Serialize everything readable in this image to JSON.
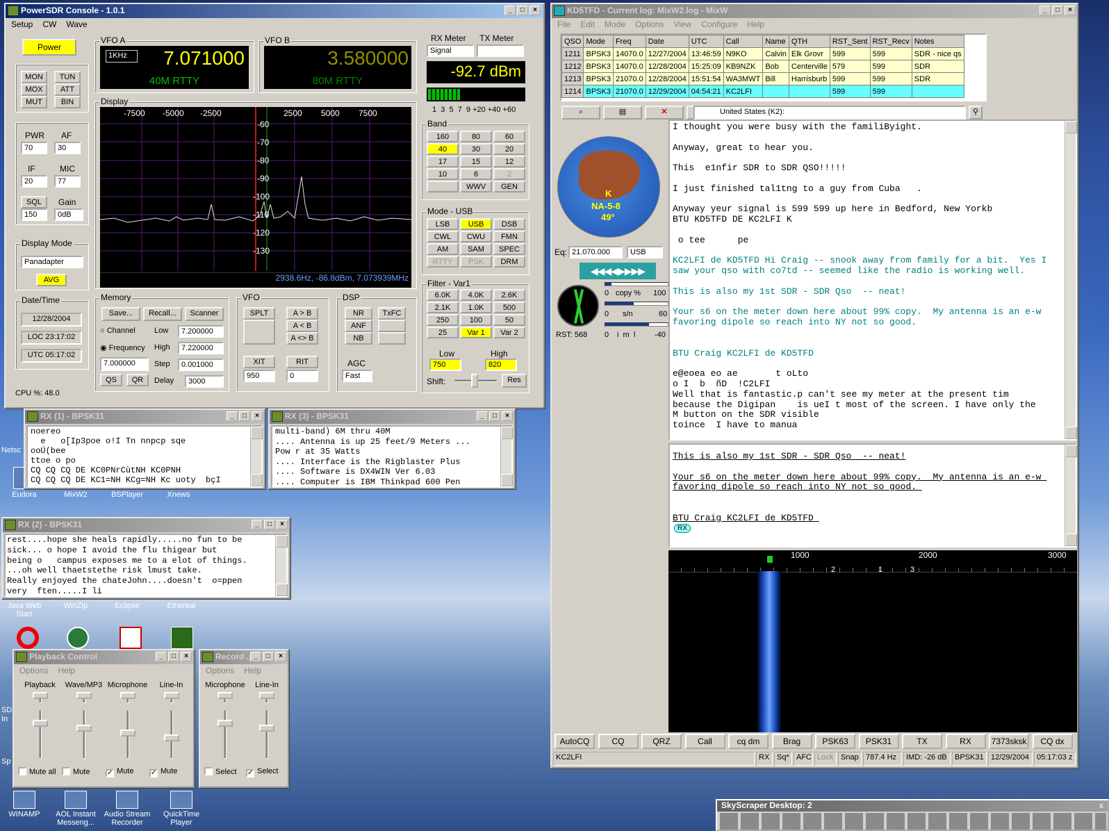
{
  "desktop": {
    "icons": [
      {
        "label": "Netsc",
        "x": 0
      },
      {
        "label": "Eudora"
      },
      {
        "label": "MixW2"
      },
      {
        "label": "BSPlayer"
      },
      {
        "label": "Xnews"
      },
      {
        "label": "Java Web Start"
      },
      {
        "label": "WinZip"
      },
      {
        "label": "Eclipse"
      },
      {
        "label": "Ethereal"
      },
      {
        "label": "WINAMP"
      },
      {
        "label": "AOL Instant Messeng..."
      },
      {
        "label": "Audio Stream Recorder"
      },
      {
        "label": "QuickTime Player"
      }
    ],
    "partial": [
      "SD",
      "In",
      "Sp"
    ]
  },
  "powersdr": {
    "title": "PowerSDR Console - 1.0.1",
    "menu": [
      "Setup",
      "CW",
      "Wave"
    ],
    "power": "Power",
    "mon": "MON",
    "tun": "TUN",
    "mox": "MOX",
    "att": "ATT",
    "mut": "MUT",
    "bin": "BIN",
    "pwr": {
      "label": "PWR",
      "value": "70"
    },
    "af": {
      "label": "AF",
      "value": "30"
    },
    "if": {
      "label": "IF",
      "value": "20"
    },
    "mic": {
      "label": "MIC",
      "value": "77"
    },
    "sql": {
      "label": "SQL",
      "value": "150"
    },
    "gain": {
      "label": "Gain",
      "value": "0dB"
    },
    "display_mode": {
      "label": "Display Mode",
      "value": "Panadapter",
      "avg": "AVG"
    },
    "datetime": {
      "label": "Date/Time",
      "date": "12/28/2004",
      "loc": "LOC 23:17:02",
      "utc": "UTC 05:17:02"
    },
    "cpu": "CPU %: 48.0",
    "vfoa": {
      "label": "VFO A",
      "step": "1KHz",
      "freq": "7.071000",
      "mode": "40M RTTY"
    },
    "vfob": {
      "label": "VFO B",
      "freq": "3.580000",
      "mode": "80M RTTY"
    },
    "display": {
      "label": "Display",
      "xlabels": [
        "-7500",
        "-5000",
        "-2500",
        "2500",
        "5000",
        "7500"
      ],
      "ylabels": [
        "-60",
        "-70",
        "-80",
        "-90",
        "-100",
        "-110",
        "-120",
        "-130"
      ],
      "readout": "2938.6Hz, -86.8dBm, 7.073939MHz"
    },
    "meter": {
      "rx_label": "RX Meter",
      "tx_label": "TX Meter",
      "rx_select": "Signal",
      "value": "-92.7 dBm",
      "scale": "1  3  5  7  9 +20 +40 +60"
    },
    "band": {
      "label": "Band",
      "buttons": [
        "160",
        "80",
        "60",
        "40",
        "30",
        "20",
        "17",
        "15",
        "12",
        "10",
        "6",
        "2",
        "",
        "WWV",
        "GEN"
      ]
    },
    "mode": {
      "label": "Mode - USB",
      "buttons": [
        "LSB",
        "USB",
        "DSB",
        "CWL",
        "CWU",
        "FMN",
        "AM",
        "SAM",
        "SPEC",
        "RTTY",
        "PSK",
        "DRM"
      ]
    },
    "filter": {
      "label": "Filter - Var1",
      "buttons": [
        "6.0K",
        "4.0K",
        "2.6K",
        "2.1K",
        "1.0K",
        "500",
        "250",
        "100",
        "50",
        "25",
        "Var 1",
        "Var 2"
      ],
      "low_label": "Low",
      "high_label": "High",
      "low": "750",
      "high": "820",
      "shift": "Shift:",
      "reset": "Res"
    },
    "memory": {
      "label": "Memory",
      "save": "Save...",
      "recall": "Recall...",
      "scanner": "Scanner",
      "channel": "Channel",
      "frequency": "Frequency",
      "low_label": "Low",
      "low": "7.200000",
      "high_label": "High",
      "high": "7.220000",
      "step_label": "Step",
      "step": "0.001000",
      "delay_label": "Delay",
      "delay": "3000",
      "freq": "7.000000",
      "qs": "QS",
      "qr": "QR"
    },
    "vfo": {
      "label": "VFO",
      "splt": "SPLT",
      "ab": "A > B",
      "alb": "A < B",
      "axb": "A <> B",
      "xit": "XIT",
      "rit": "RIT",
      "xitv": "950",
      "ritv": "0"
    },
    "dsp": {
      "label": "DSP",
      "nr": "NR",
      "txfc": "TxFC",
      "anf": "ANF",
      "nb": "NB",
      "agc": "AGC",
      "agcv": "Fast"
    }
  },
  "rx1": {
    "title": "RX (1) - BPSK31",
    "lines": [
      "noereo",
      "  e   o[Ip3poe o!I Tn nnpcp sqe",
      "ooÚ(bee",
      "ttoe o po",
      "CQ CQ CQ DE KC0PNrCùtNH KC0PNH",
      "CQ CQ CQ DE KC1=NH KCg=NH Kc uoty  bçI"
    ]
  },
  "rx3": {
    "title": "RX (3) - BPSK31",
    "lines": [
      "multi-band) 6M thru 40M",
      ".... Antenna is up 25 feet/9 Meters ...",
      "Pow r at 35 Watts",
      ".... Interface is the Rigblaster Plus",
      ".... Software is DX4WIN Ver 6.03",
      ".... Computer is IBM Thinkpad 600 Pen"
    ]
  },
  "rx2": {
    "title": "RX (2) - BPSK31",
    "lines": [
      "rest....hope she heals rapidly.....no fun to be",
      "sick... o hope I avoid the flu thigear but",
      "being o   campus exposes me to a elot of things.",
      "...oh well thaetstethe risk lmust take.",
      "Really enjoyed the chateJohn....doesn't  o=ppen",
      "very  ften.....I li"
    ]
  },
  "playback": {
    "title": "Playback Control",
    "menu": [
      "Options",
      "Help"
    ],
    "channels": [
      {
        "name": "Playback",
        "mute": "Mute all",
        "checked": false
      },
      {
        "name": "Wave/MP3",
        "mute": "Mute",
        "checked": false
      },
      {
        "name": "Microphone",
        "mute": "Mute",
        "checked": true
      },
      {
        "name": "Line-In",
        "mute": "Mute",
        "checked": true
      }
    ]
  },
  "record": {
    "title": "Record ...",
    "menu": [
      "Options",
      "Help"
    ],
    "channels": [
      {
        "name": "Microphone",
        "mute": "Select",
        "checked": false
      },
      {
        "name": "Line-In",
        "mute": "Select",
        "checked": true
      }
    ]
  },
  "mixw": {
    "title": "KD5TFD - Current log: MixW2.log - MixW",
    "menu": [
      "File",
      "Edit",
      "Mode",
      "Options",
      "View",
      "Configure",
      "Help"
    ],
    "log_headers": [
      "QSO",
      "Mode",
      "Freq",
      "Date",
      "UTC",
      "Call",
      "Name",
      "QTH",
      "RST_Sent",
      "RST_Recv",
      "Notes"
    ],
    "log_rows": [
      [
        "1211",
        "BPSK3",
        "14070.0",
        "12/27/2004",
        "13:46:59",
        "N9KO",
        "Calvin",
        "Elk Grovr",
        "599",
        "599",
        "SDR - nice qs"
      ],
      [
        "1212",
        "BPSK3",
        "14070.0",
        "12/28/2004",
        "15:25:09",
        "KB9NZK",
        "Bob",
        "Centerville",
        "579",
        "599",
        "SDR"
      ],
      [
        "1213",
        "BPSK3",
        "21070.0",
        "12/28/2004",
        "15:51:54",
        "WA3MWT",
        "Bill",
        "Harrisburb",
        "599",
        "599",
        "SDR"
      ],
      [
        "1214",
        "BPSK3",
        "21070.0",
        "12/29/2004",
        "04:54:21",
        "KC2LFI",
        "",
        "",
        "599",
        "599",
        ""
      ]
    ],
    "country": "United States (K2):",
    "globe": {
      "k": "K",
      "grid": "NA-5-8",
      "deg": "49°"
    },
    "eq_label": "Eq:",
    "eq": "21.070.000",
    "mode": "USB",
    "meters": {
      "copy": "copy %",
      "copy_min": "0",
      "copy_max": "100",
      "sn": "s/n",
      "sn_min": "0",
      "sn_max": "60",
      "imd": "i  m  l",
      "imd_min": "0",
      "imd_max": "-40",
      "rst": "RST: 568"
    },
    "rx_text": [
      {
        "t": "I thought you were busy with the familiByight.",
        "c": "#000"
      },
      {
        "t": "",
        "c": "#000"
      },
      {
        "t": "Anyway, great to hear you.",
        "c": "#000"
      },
      {
        "t": "",
        "c": "#000"
      },
      {
        "t": "This  e1nfir SDR to SDR QSO!!!!!",
        "c": "#000"
      },
      {
        "t": "",
        "c": "#000"
      },
      {
        "t": "I just finished tal1tng to a guy from Cuba   .",
        "c": "#000"
      },
      {
        "t": "",
        "c": "#000"
      },
      {
        "t": "Anyway yeur signal is 599 599 up here in Bedford, New Yorkb",
        "c": "#000"
      },
      {
        "t": "BTU KD5TFD DE KC2LFI K",
        "c": "#000"
      },
      {
        "t": "",
        "c": "#000"
      },
      {
        "t": " o tee      pe",
        "c": "#000"
      },
      {
        "t": "",
        "c": "#000"
      },
      {
        "t": "KC2LFI de KD5TFD Hi Craig -- snook away from family for a bit.  Yes I",
        "c": "#008080"
      },
      {
        "t": "saw your qso with co7td -- seemed like the radio is working well.",
        "c": "#008080"
      },
      {
        "t": "",
        "c": "#000"
      },
      {
        "t": "This is also my 1st SDR - SDR Qso  -- neat!",
        "c": "#008080"
      },
      {
        "t": "",
        "c": "#000"
      },
      {
        "t": "Your s6 on the meter down here about 99% copy.  My antenna is an e-w",
        "c": "#008080"
      },
      {
        "t": "favoring dipole so reach into NY not so good.",
        "c": "#008080"
      },
      {
        "t": "",
        "c": "#000"
      },
      {
        "t": "",
        "c": "#000"
      },
      {
        "t": "BTU Craig KC2LFI de KD5TFD",
        "c": "#008080"
      },
      {
        "t": "",
        "c": "#000"
      },
      {
        "t": "e@eoea eo ae       t oLto",
        "c": "#000"
      },
      {
        "t": "o I  b  ñD  !C2LFI",
        "c": "#000"
      },
      {
        "t": "Well that is fantastic.p can't see my meter at the present tim",
        "c": "#000"
      },
      {
        "t": "because the Digipan    is ueI t most of the screen. I have only the",
        "c": "#000"
      },
      {
        "t": "M button on the SDR visible",
        "c": "#000"
      },
      {
        "t": "toince  I have to manua",
        "c": "#000"
      }
    ],
    "tx_text": [
      "This is also my 1st SDR - SDR Qso  -- neat!",
      "",
      "Your s6 on the meter down here about 99% copy.  My antenna is an e-w ",
      "favoring dipole so reach into NY not so good. ",
      "",
      "",
      "BTU Craig KC2LFI de KD5TFD "
    ],
    "tx_rx_tag": "RX",
    "waterfall": {
      "scale": [
        "1000",
        "2000",
        "3000"
      ],
      "markers": [
        "2",
        "1",
        "3"
      ]
    },
    "macros": [
      "AutoCQ",
      "CQ",
      "QRZ",
      "Call",
      "cq dm",
      "Brag",
      "PSK63",
      "PSK31",
      "TX",
      "RX",
      "7373sksk",
      "CQ dx"
    ],
    "status": {
      "call": "KC2LFI",
      "rx": "RX",
      "sq": "Sq*",
      "afc": "AFC",
      "lock": "Lock",
      "snap": "Snap",
      "hz": "787.4 Hz",
      "imd": "IMD: -26 dB",
      "mode": "BPSK31",
      "date": "12/29/2004",
      "time": "05:17:03 z"
    }
  },
  "taskbar": {
    "title": "SkyScraper Desktop: 2",
    "close": "x"
  }
}
